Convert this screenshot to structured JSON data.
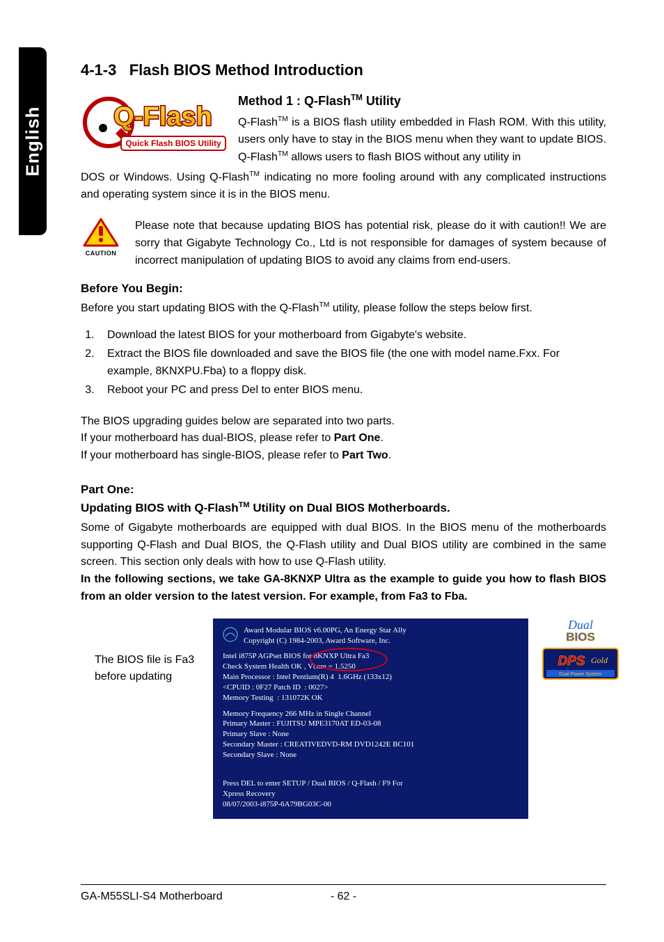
{
  "language_tab": "English",
  "section_number": "4-1-3",
  "section_title": "Flash BIOS Method Introduction",
  "method1_title_prefix": "Method 1 : Q-Flash",
  "method1_title_suffix": " Utility",
  "tm": "TM",
  "intro": {
    "p1_a": "Q-Flash",
    "p1_b": " is a BIOS flash utility embedded in Flash ROM. With this utility, users only have to stay in the BIOS menu when they want to update BIOS. Q-Flash",
    "p1_c": " allows users to flash BIOS without any utility in",
    "p2_a": "DOS or Windows. Using Q-Flash",
    "p2_b": " indicating no more fooling around with any complicated instructions and operating system since it is in the BIOS menu."
  },
  "caution_label": "CAUTION",
  "caution_text": "Please note that because updating BIOS has potential risk, please do it with caution!! We are sorry that Gigabyte Technology Co., Ltd is not responsible for damages of system because of incorrect manipulation of updating BIOS to avoid any claims from end-users.",
  "before_begin_head": "Before You Begin:",
  "before_begin_intro_a": "Before you start updating BIOS with the Q-Flash",
  "before_begin_intro_b": " utility, please follow the steps below first.",
  "steps": [
    "Download the latest BIOS for your motherboard from Gigabyte's website.",
    "Extract the BIOS file downloaded and save the BIOS file (the one with model name.Fxx. For example, 8KNXPU.Fba) to a floppy disk.",
    "Reboot your PC and press Del to enter BIOS menu."
  ],
  "step3_prefix": "Reboot your PC and press ",
  "step3_bold": "Del",
  "step3_suffix": " to enter BIOS menu.",
  "guides_intro1": "The BIOS upgrading guides below are separated into two parts.",
  "guides_intro2_a": "If your motherboard has dual-BIOS, please refer to ",
  "guides_intro2_bold": "Part One",
  "guides_intro3_a": "If your motherboard has single-BIOS, please refer to ",
  "guides_intro3_bold": "Part Two",
  "period": ".",
  "part_one_head": "Part One:",
  "part_one_sub_a": "Updating BIOS with Q-Flash",
  "part_one_sub_b": " Utility on Dual BIOS Motherboards.",
  "part_one_body": "Some of Gigabyte motherboards are equipped with dual BIOS. In the BIOS menu of the motherboards supporting Q-Flash and Dual BIOS, the Q-Flash utility and Dual BIOS utility are combined in the same screen. This section only deals with how to use Q-Flash utility.",
  "part_one_bold": "In the following sections, we take GA-8KNXP Ultra as the example to guide you how to flash BIOS from an older version to the latest version. For example, from Fa3 to Fba.",
  "bios_caption": "The BIOS file is Fa3 before updating",
  "bios": {
    "h1": "Award Modular BIOS v6.00PG, An Energy Star Ally",
    "h2": "Copyright (C) 1984-2003, Award Software, Inc.",
    "l1": "Intel i875P AGPset BIOS for 8KNXP Ultra Fa3",
    "l2": "Check System Health OK , Vcore = 1.5250",
    "l3": "Main Processor : Intel Pentium(R) 4  1.6GHz (133x12)",
    "l4": "<CPUID : 0F27 Patch ID  : 0027>",
    "l5": "Memory Testing  : 131072K OK",
    "m1": "Memory Frequency 266 MHz in Single Channel",
    "m2": "Primary Master : FUJITSU MPE3170AT ED-03-08",
    "m3": "Primary Slave : None",
    "m4": "Secondary Master : CREATIVEDVD-RM DVD1242E BC101",
    "m5": "Secondary Slave : None",
    "f1": "Press DEL to enter SETUP / Dual BIOS / Q-Flash / F9 For",
    "f2": "Xpress Recovery",
    "f3": "08/07/2003-i875P-6A79BG03C-00"
  },
  "qflash_logo": {
    "main": "Q-Flash",
    "sub": "Quick Flash BIOS Utility"
  },
  "badges": {
    "dualbios_top": "Dual",
    "dualbios_bottom": "BIOS",
    "dps_top": "DPS",
    "dps_mid": "Gold",
    "dps_bottom": "Dual Power System"
  },
  "footer": {
    "left": "GA-M55SLI-S4 Motherboard",
    "page": "- 62 -"
  }
}
